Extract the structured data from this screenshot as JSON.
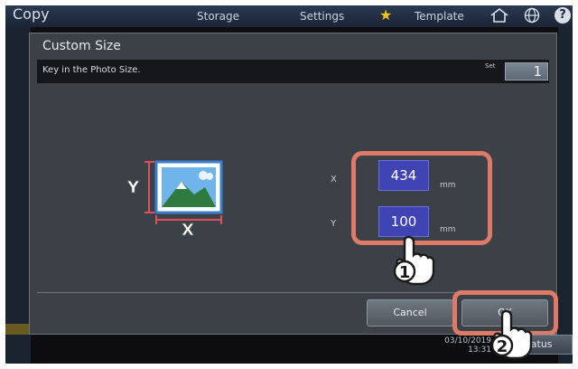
{
  "app": {
    "title": "Copy"
  },
  "topbar": {
    "tabs": [
      {
        "label": "Storage"
      },
      {
        "label": "Settings"
      },
      {
        "label": "Template"
      }
    ],
    "icons": [
      "star-icon",
      "home-icon",
      "globe-icon",
      "info-icon"
    ],
    "info_glyph": "?"
  },
  "dialog": {
    "title": "Custom Size",
    "instruction": "Key in the Photo Size.",
    "set": {
      "label": "Set",
      "value": "1"
    },
    "fields": [
      {
        "label": "X",
        "value": "434",
        "unit": "mm"
      },
      {
        "label": "Y",
        "value": "100",
        "unit": "mm"
      }
    ],
    "diagram": {
      "label_x": "X",
      "label_y": "Y"
    },
    "buttons": {
      "cancel": "Cancel",
      "ok": "OK"
    }
  },
  "footer": {
    "clock_date": "03/10/2019",
    "clock_time": "13:31",
    "status_label": "Status"
  },
  "callouts": {
    "step1": "1",
    "step2": "2"
  },
  "colors": {
    "highlight": "#e07a68",
    "input_fill": "#3f43b4",
    "accent_star": "#f0c419"
  }
}
